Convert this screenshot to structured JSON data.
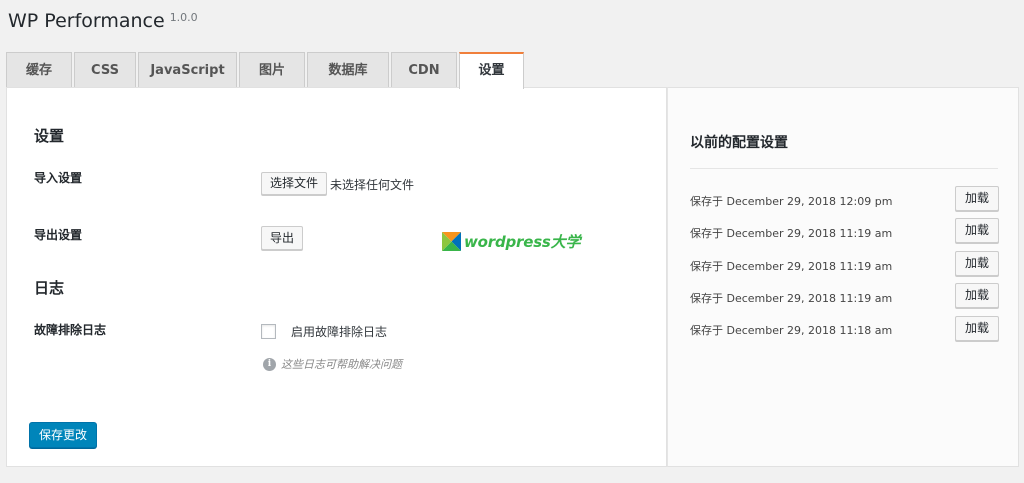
{
  "header": {
    "title": "WP Performance",
    "version": "1.0.0"
  },
  "tabs": [
    {
      "label": "缓存"
    },
    {
      "label": "CSS"
    },
    {
      "label": "JavaScript"
    },
    {
      "label": "图片"
    },
    {
      "label": "数据库"
    },
    {
      "label": "CDN"
    },
    {
      "label": "设置",
      "active": true
    }
  ],
  "settings": {
    "section_title": "设置",
    "import_label": "导入设置",
    "choose_file_button": "选择文件",
    "no_file_text": "未选择任何文件",
    "export_label": "导出设置",
    "export_button": "导出"
  },
  "logs": {
    "section_title": "日志",
    "debug_label": "故障排除日志",
    "enable_checkbox_label": "启用故障排除日志",
    "enabled": false,
    "hint": "这些日志可帮助解决问题"
  },
  "watermark": {
    "text": "wordpress大学"
  },
  "save_button": "保存更改",
  "previous_configs": {
    "title": "以前的配置设置",
    "load_label": "加载",
    "items": [
      {
        "text": "保存于 December 29, 2018 12:09 pm"
      },
      {
        "text": "保存于 December 29, 2018 11:19 am"
      },
      {
        "text": "保存于 December 29, 2018 11:19 am"
      },
      {
        "text": "保存于 December 29, 2018 11:19 am"
      },
      {
        "text": "保存于 December 29, 2018 11:18 am"
      }
    ]
  }
}
